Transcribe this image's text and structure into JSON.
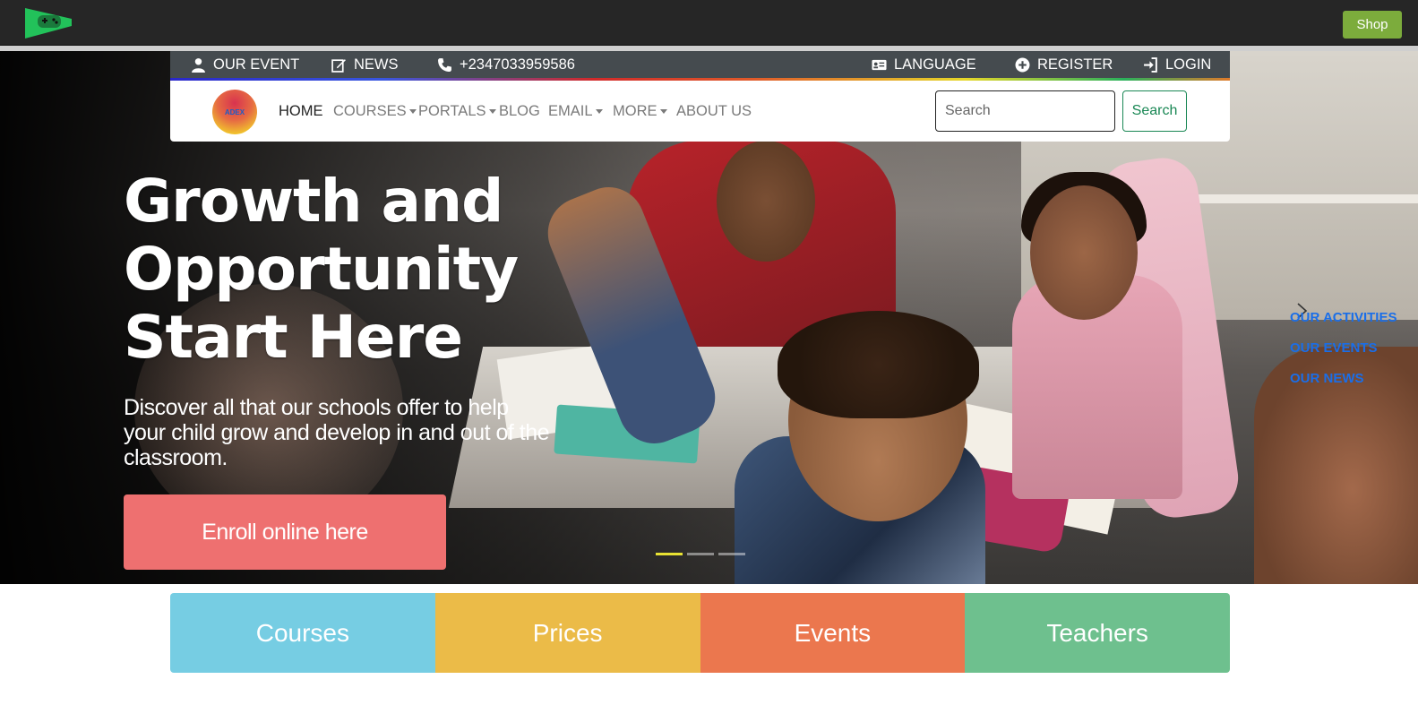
{
  "topbar": {
    "shop_label": "Shop",
    "accent": "#7cac3c"
  },
  "infobar": {
    "our_event": "OUR EVENT",
    "news": "NEWS",
    "phone": "+2347033959586",
    "language": "LANGUAGE",
    "register": "REGISTER",
    "login": "LOGIN"
  },
  "nav": {
    "logo_text": "ADEX",
    "items": [
      {
        "label": "HOME",
        "dropdown": false
      },
      {
        "label": "COURSES",
        "dropdown": true
      },
      {
        "label": "PORTALS",
        "dropdown": true
      },
      {
        "label": "BLOG",
        "dropdown": false
      },
      {
        "label": "EMAIL",
        "dropdown": true
      },
      {
        "label": "MORE",
        "dropdown": true
      },
      {
        "label": "ABOUT US",
        "dropdown": false
      }
    ],
    "search_placeholder": "Search",
    "search_button": "Search"
  },
  "hero": {
    "title_line1": "Growth and",
    "title_line2": "Opportunity",
    "title_line3": "Start Here",
    "subtitle": "Discover all that our schools offer to help your child grow and develop in and out of the classroom.",
    "cta": "Enroll online here",
    "cta_color": "#ee7070",
    "side_links": [
      "OUR ACTIVITIES",
      "OUR EVENTS",
      "OUR NEWS"
    ],
    "slides": 3,
    "active_slide": 1
  },
  "tiles": [
    {
      "label": "Courses",
      "color": "#76cde3"
    },
    {
      "label": "Prices",
      "color": "#ebbb48"
    },
    {
      "label": "Events",
      "color": "#eb774e"
    },
    {
      "label": "Teachers",
      "color": "#6ec08e"
    }
  ]
}
